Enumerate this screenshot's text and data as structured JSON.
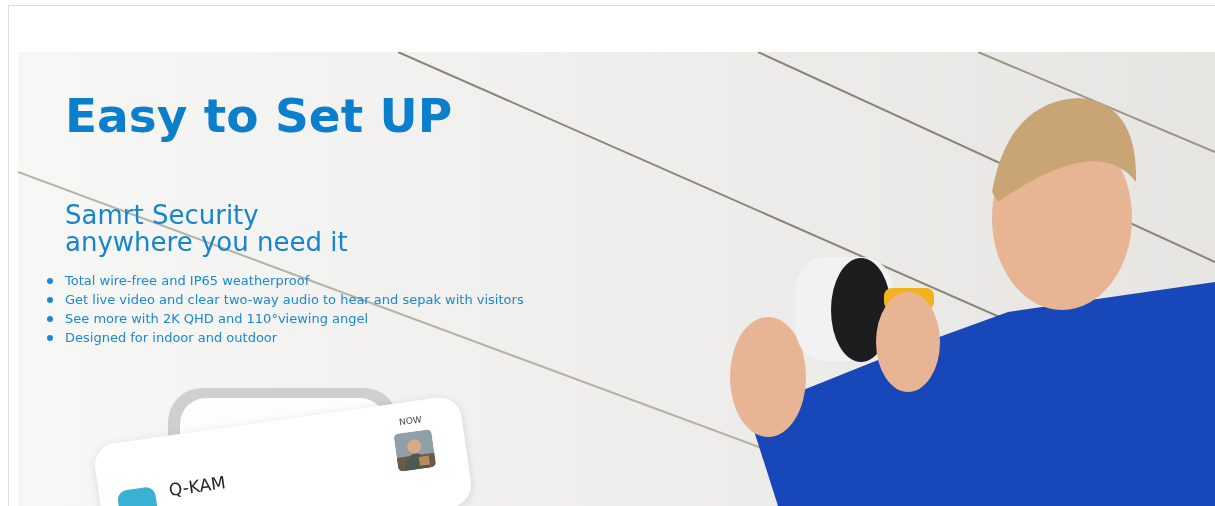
{
  "banner": {
    "title": "Easy to Set UP",
    "subtitle_lines": [
      "Samrt Security",
      "anywhere you need it"
    ],
    "features": [
      "Total wire-free and IP65 weatherproof",
      "Get live video and clear two-way audio to hear and sepak with visitors",
      "See more with 2K QHD and 110°viewing angel",
      "Designed  for indoor and outdoor"
    ],
    "notification": {
      "app_name": "Q-KAM",
      "time": "NOW"
    }
  }
}
